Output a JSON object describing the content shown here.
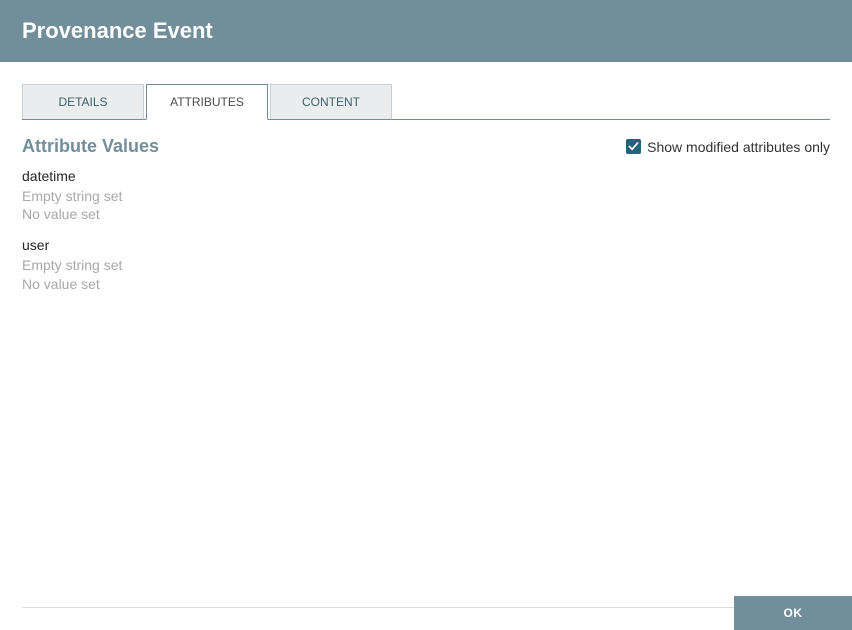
{
  "header": {
    "title": "Provenance Event"
  },
  "tabs": {
    "details": "Details",
    "attributes": "Attributes",
    "content": "Content",
    "active": "attributes"
  },
  "panel": {
    "sectionTitle": "Attribute Values",
    "showModifiedLabel": "Show modified attributes only",
    "showModifiedChecked": true
  },
  "attributes": [
    {
      "name": "datetime",
      "original": "Empty string set",
      "current": "No value set"
    },
    {
      "name": "user",
      "original": "Empty string set",
      "current": "No value set"
    }
  ],
  "footer": {
    "ok": "OK"
  }
}
